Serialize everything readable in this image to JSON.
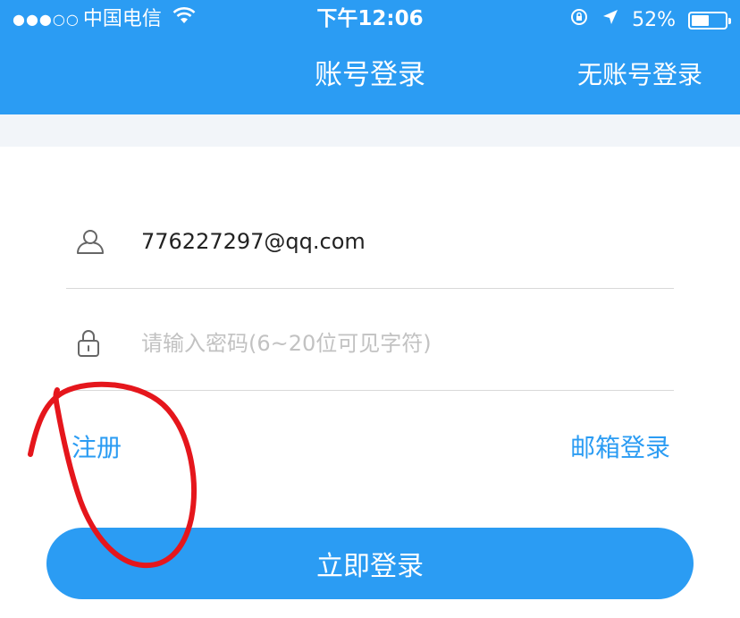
{
  "status_bar": {
    "signal": "●●●○○",
    "carrier": "中国电信",
    "time": "下午12:06",
    "battery_percent": "52%",
    "battery_level": 0.52
  },
  "nav": {
    "title": "账号登录",
    "right_action": "无账号登录"
  },
  "form": {
    "username": {
      "value": "776227297@qq.com",
      "icon": "user-icon"
    },
    "password": {
      "value": "",
      "placeholder": "请输入密码(6~20位可见字符)",
      "icon": "lock-icon"
    }
  },
  "links": {
    "register": "注册",
    "email_login": "邮箱登录"
  },
  "login_button": "立即登录",
  "colors": {
    "accent": "#2b9cf3",
    "annotation": "#e5161c",
    "placeholder": "#c2c2c2"
  }
}
